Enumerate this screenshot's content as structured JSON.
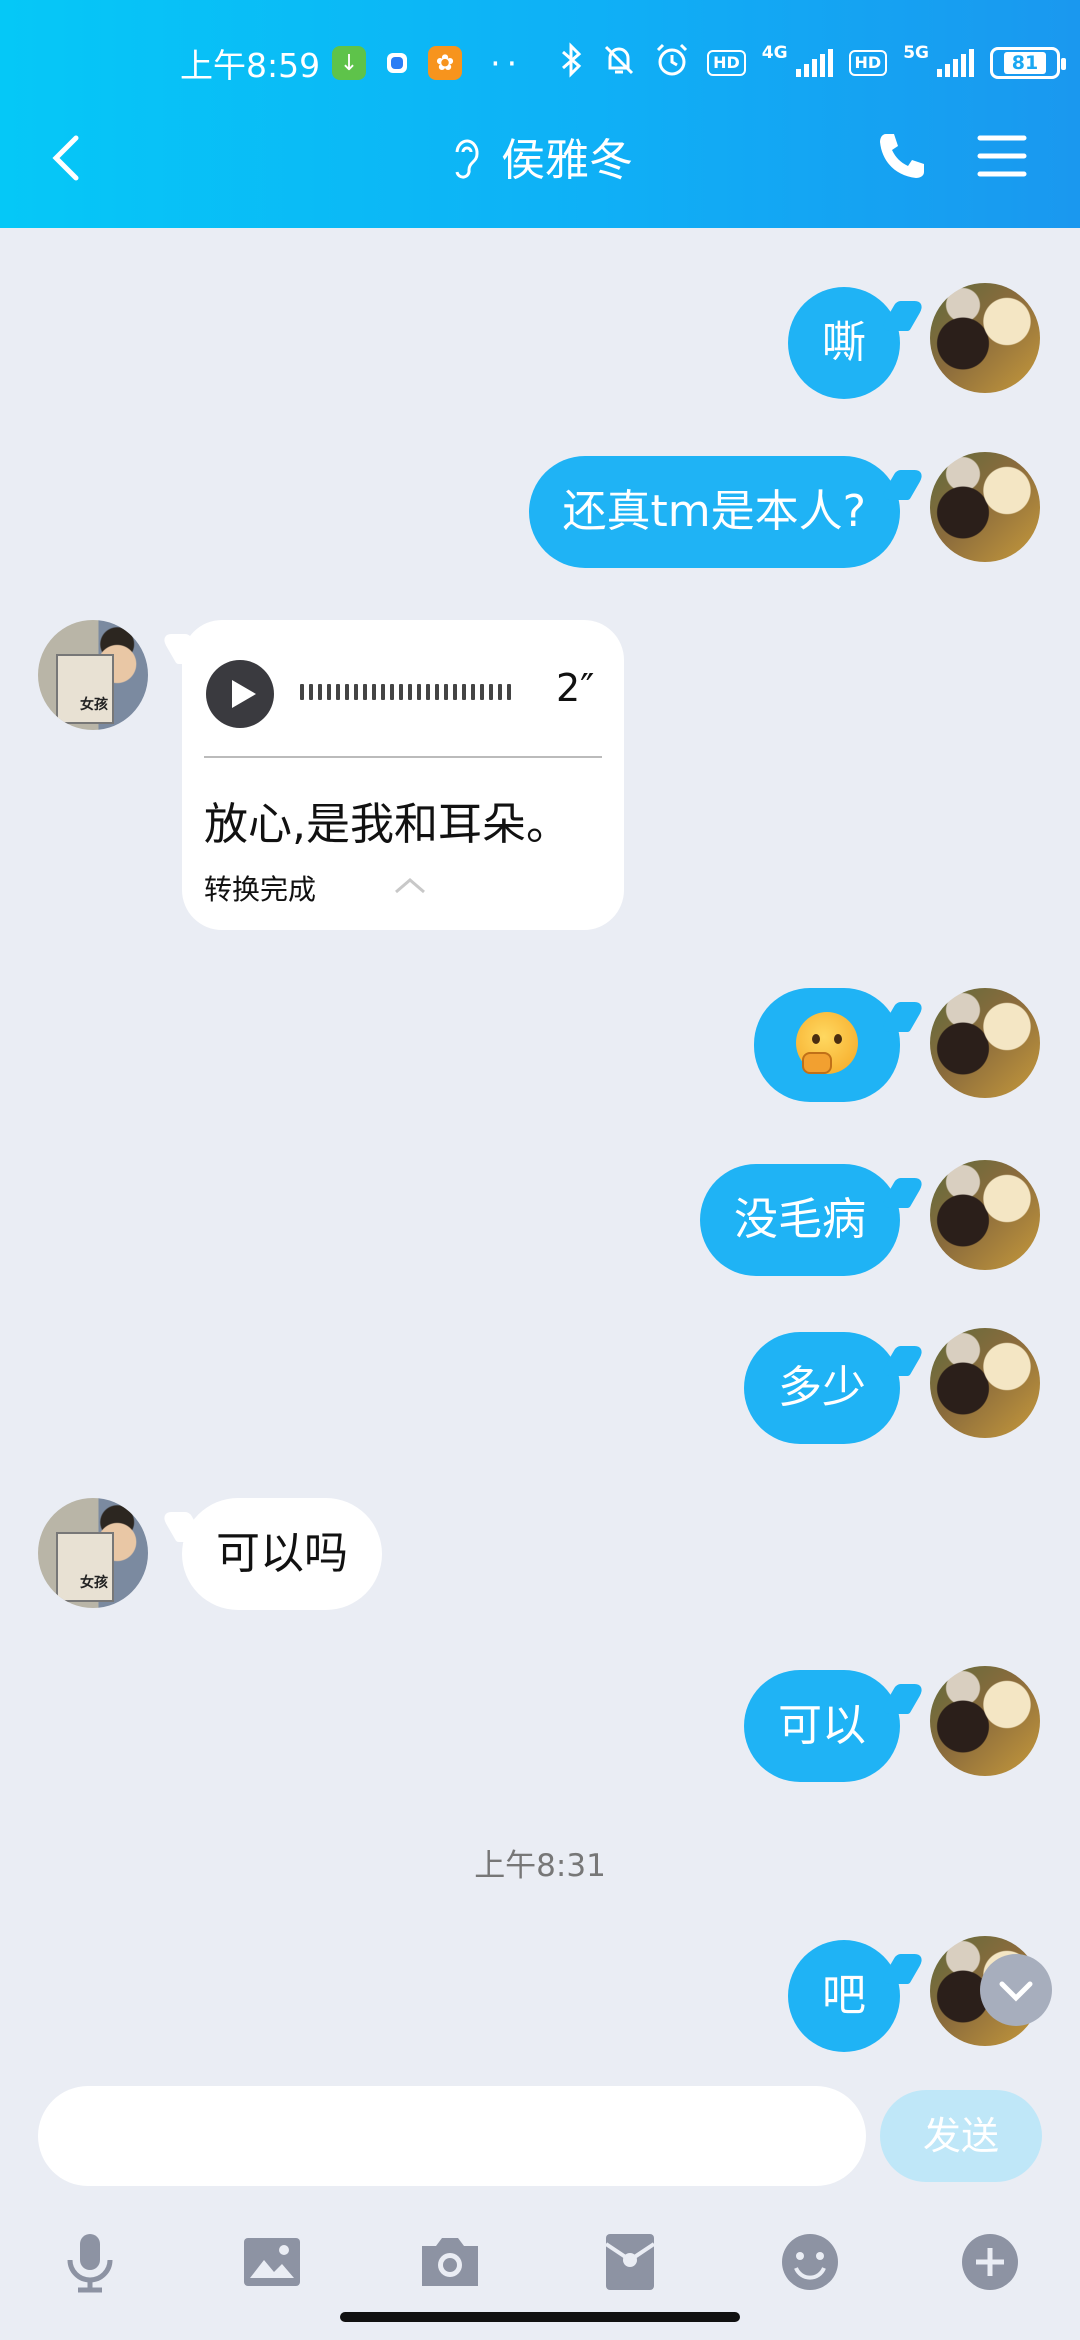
{
  "status_bar": {
    "time": "上午8:59",
    "network_4g": "4G",
    "network_5g": "5G",
    "hd": "HD",
    "battery": "81"
  },
  "nav": {
    "contact_name": "侯雅冬",
    "back_icon": "chevron-left-icon",
    "phone_icon": "phone-icon",
    "menu_icon": "hamburger-menu-icon"
  },
  "messages": [
    {
      "sender": "me",
      "text": "嘶"
    },
    {
      "sender": "me",
      "text": "还真tm是本人?"
    },
    {
      "sender": "other",
      "type": "voice",
      "duration": "2″",
      "transcript": "放心,是我和耳朵。",
      "status": "转换完成"
    },
    {
      "sender": "me",
      "type": "emoji",
      "emoji": "thinking-face"
    },
    {
      "sender": "me",
      "text": "没毛病"
    },
    {
      "sender": "me",
      "text": "多少"
    },
    {
      "sender": "other",
      "text": "可以吗"
    },
    {
      "sender": "me",
      "text": "可以"
    },
    {
      "type": "timestamp",
      "text": "上午8:31"
    },
    {
      "sender": "me",
      "text": "吧"
    }
  ],
  "input": {
    "value": "",
    "send_label": "发送"
  },
  "toolbar": [
    "microphone-icon",
    "image-icon",
    "camera-icon",
    "red-packet-icon",
    "emoji-icon",
    "plus-icon"
  ],
  "colors": {
    "header_start": "#05c8f7",
    "header_end": "#1a98ef",
    "my_bubble": "#1fb3f5",
    "background": "#eaedf4"
  }
}
